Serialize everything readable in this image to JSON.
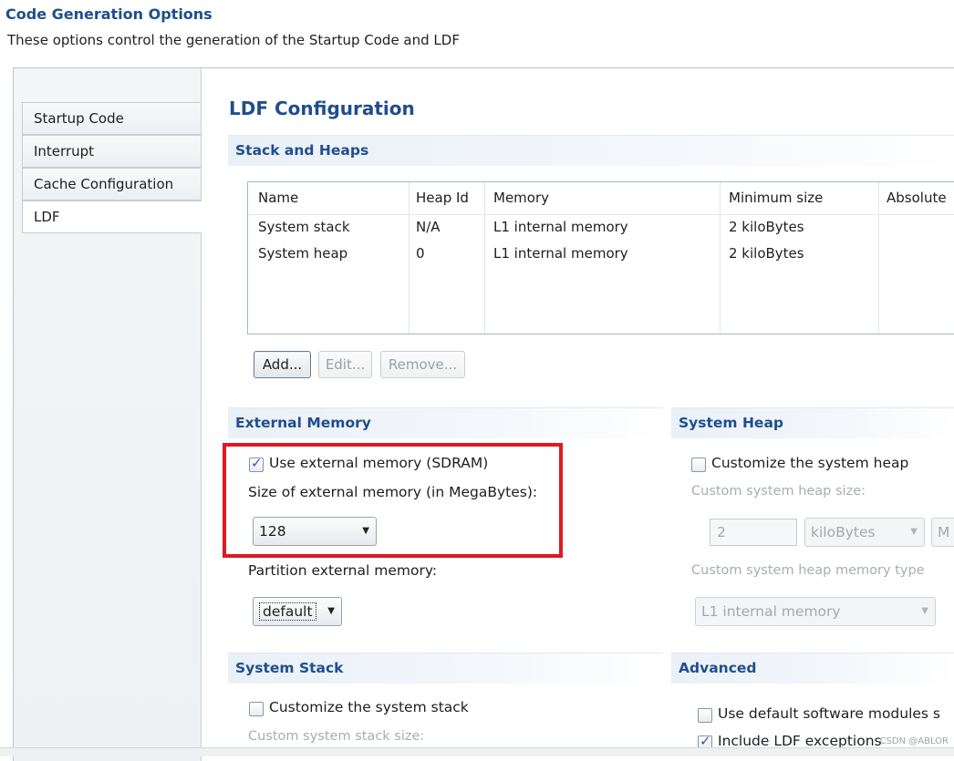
{
  "header": {
    "title": "Code Generation Options",
    "description": "These options control the generation of the Startup Code and LDF"
  },
  "tabs": [
    {
      "label": "Startup Code",
      "active": false
    },
    {
      "label": "Interrupt",
      "active": false
    },
    {
      "label": "Cache Configuration",
      "active": false
    },
    {
      "label": "LDF",
      "active": true
    }
  ],
  "main": {
    "section_title": "LDF Configuration",
    "stack_heaps": {
      "title": "Stack and Heaps",
      "columns": [
        "Name",
        "Heap Id",
        "Memory",
        "Minimum size",
        "Absolute"
      ],
      "rows": [
        [
          "System stack",
          "N/A",
          "L1 internal memory",
          "2 kiloBytes",
          ""
        ],
        [
          "System heap",
          "0",
          "L1 internal memory",
          "2 kiloBytes",
          ""
        ]
      ],
      "buttons": {
        "add": "Add...",
        "edit": "Edit...",
        "remove": "Remove..."
      }
    },
    "external_memory": {
      "title": "External Memory",
      "use_checkbox_label": "Use external memory (SDRAM)",
      "use_checked": true,
      "size_label": "Size of external memory (in MegaBytes):",
      "size_value": "128",
      "partition_label": "Partition external memory:",
      "partition_value": "default"
    },
    "system_heap": {
      "title": "System Heap",
      "customize_label": "Customize the system heap",
      "customize_checked": false,
      "size_label": "Custom system heap size:",
      "size_value": "2",
      "unit_value": "kiloBytes",
      "extra_value": "M",
      "memory_type_label": "Custom system heap memory type",
      "memory_type_value": "L1 internal memory"
    },
    "system_stack": {
      "title": "System Stack",
      "customize_label": "Customize the system stack",
      "customize_checked": false,
      "size_label": "Custom system stack size:"
    },
    "advanced": {
      "title": "Advanced",
      "default_modules_label": "Use default software modules s",
      "default_modules_checked": false,
      "include_ldf_label": "Include LDF exceptions",
      "include_ldf_checked": true
    }
  },
  "watermark": "CSDN @ABLOR",
  "colors": {
    "accent": "#1f4e8c",
    "highlight": "#e01822"
  }
}
